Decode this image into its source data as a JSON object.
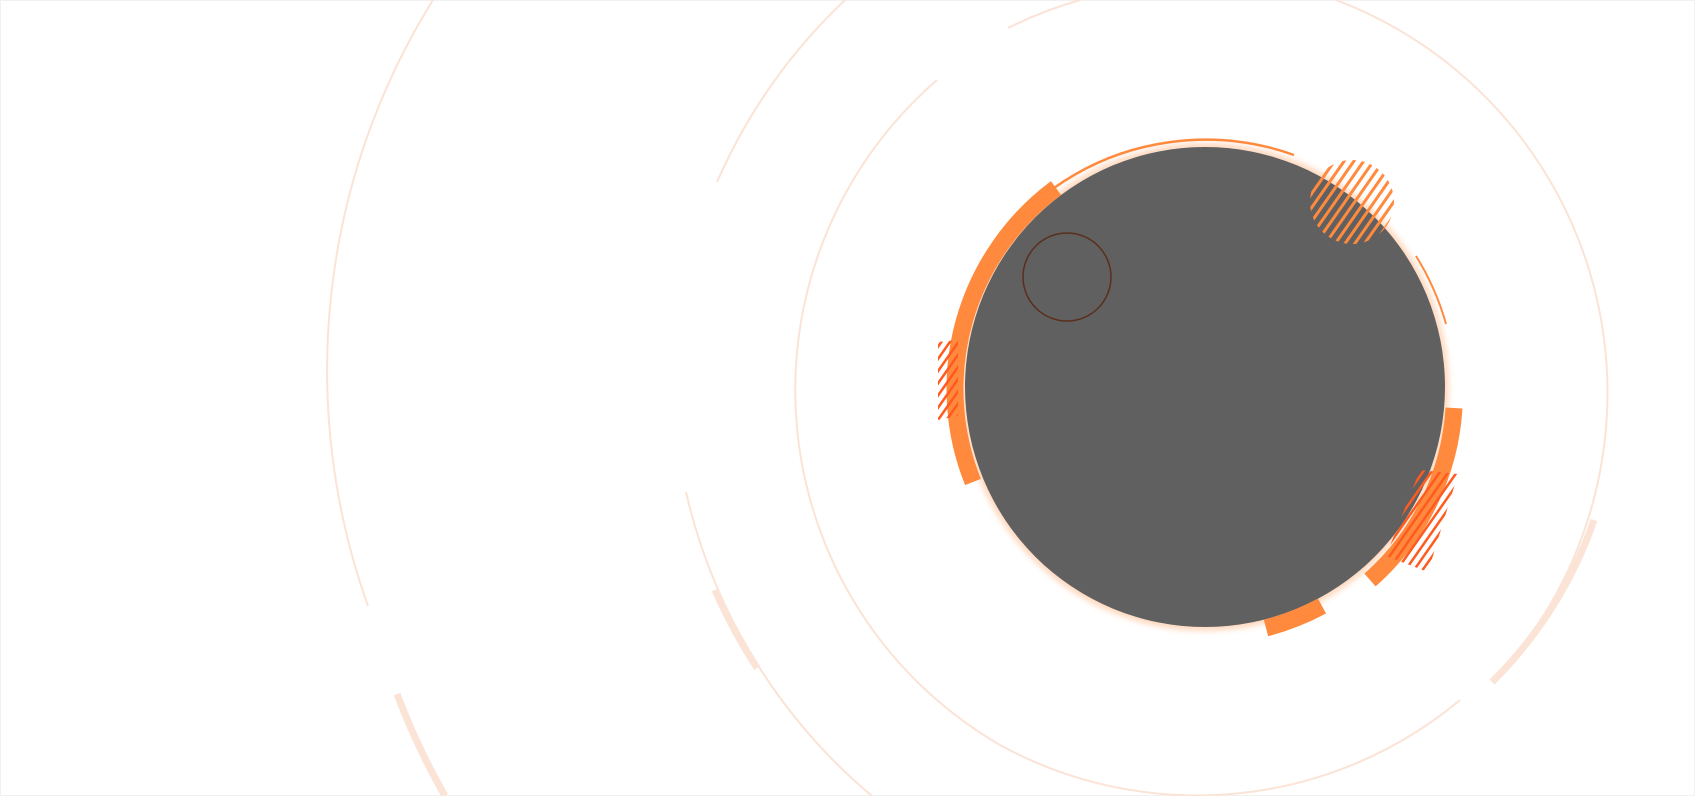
{
  "scene": {
    "description_visible_text": "",
    "colors": {
      "background": "#ffffff",
      "disc": "#606060",
      "accent_orange": "#ff8a3d",
      "accent_red": "#ff5a1f",
      "faint_ring": "#fbe3d6",
      "small_ring_stroke": "#5a2e1c",
      "glow": "#ffd9bf"
    }
  }
}
